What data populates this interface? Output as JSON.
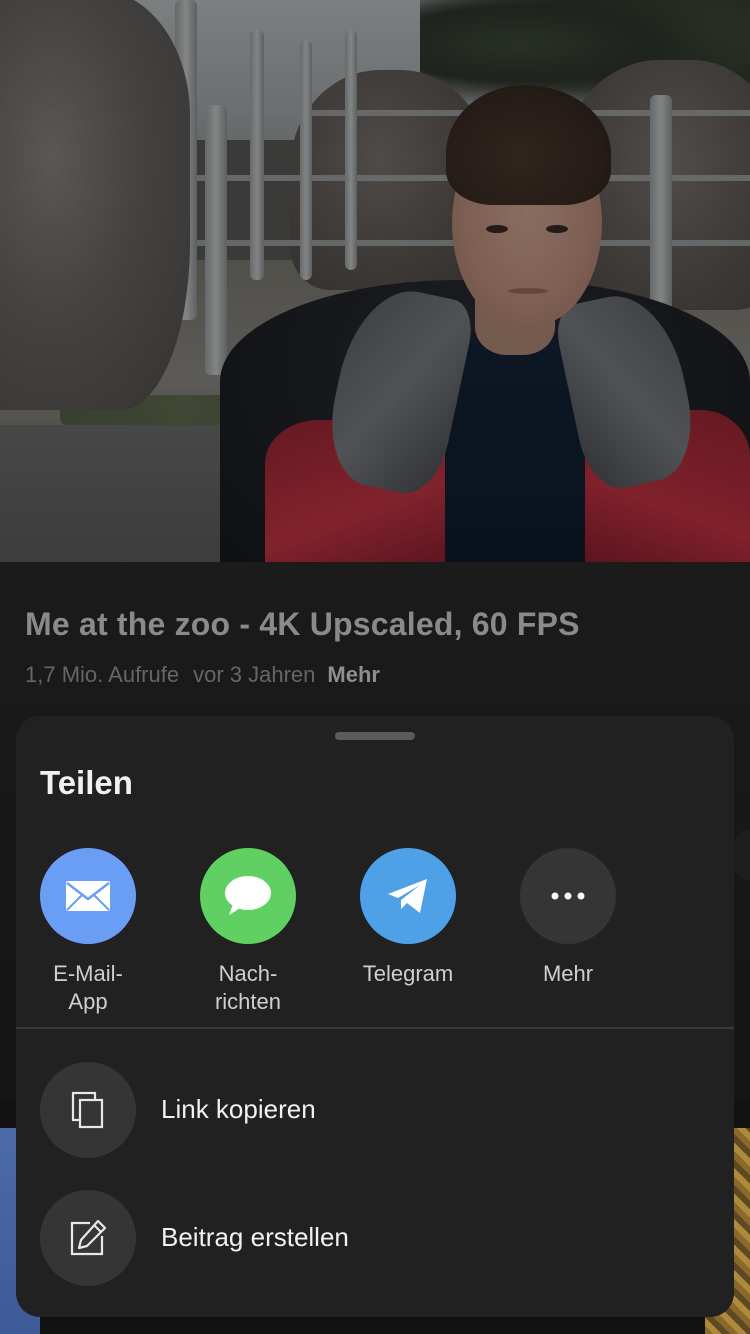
{
  "video": {
    "title": "Me at the zoo - 4K Upscaled, 60 FPS",
    "views": "1,7 Mio. Aufrufe",
    "age": "vor 3 Jahren",
    "more_label": "Mehr"
  },
  "share_sheet": {
    "title": "Teilen",
    "apps": [
      {
        "label": "E-Mail-\nApp",
        "icon": "mail-icon",
        "color": "#6a9ef5"
      },
      {
        "label": "Nach-\nrichten",
        "icon": "message-bubble-icon",
        "color": "#5fd061"
      },
      {
        "label": "Telegram",
        "icon": "telegram-icon",
        "color": "#4ea1e6"
      },
      {
        "label": "Mehr",
        "icon": "more-dots-icon",
        "color": "#353535"
      }
    ],
    "actions": [
      {
        "label": "Link kopieren",
        "icon": "copy-icon"
      },
      {
        "label": "Beitrag erstellen",
        "icon": "edit-post-icon"
      }
    ]
  }
}
